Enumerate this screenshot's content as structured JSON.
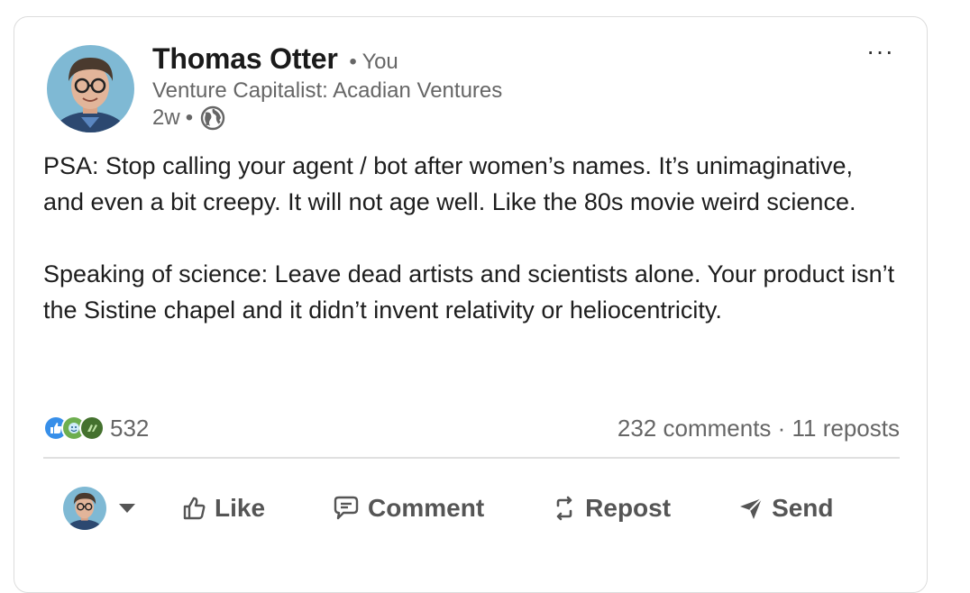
{
  "post": {
    "author": {
      "name": "Thomas Otter",
      "relation": "• You",
      "headline": "Venture Capitalist: Acadian Ventures",
      "age": "2w",
      "visibility_dot": "•",
      "visibility_icon": "globe-icon"
    },
    "menu_label": "···",
    "body": [
      "PSA: Stop calling your agent / bot after women’s names. It’s unimaginative, and even a bit creepy. It will not age well. Like the 80s movie weird science.",
      "Speaking of science: Leave dead artists and scientists alone. Your product isn’t the Sistine chapel and it didn’t invent relativity or heliocentricity."
    ],
    "social": {
      "reaction_icons": [
        "like-icon",
        "celebrate-icon",
        "support-icon"
      ],
      "reaction_count": "532",
      "comments_reposts": "232 comments · 11 reposts"
    },
    "actions": {
      "like": "Like",
      "comment": "Comment",
      "repost": "Repost",
      "send": "Send"
    }
  },
  "colors": {
    "text_primary": "#1d1d1d",
    "text_secondary": "#666666",
    "border": "#dcdcdc",
    "like_blue": "#378fe9",
    "celebrate_teal": "#44712e"
  }
}
